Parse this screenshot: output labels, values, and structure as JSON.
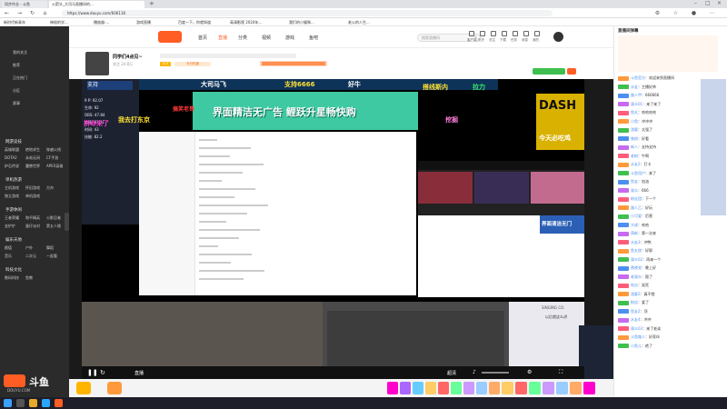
{
  "browser": {
    "tabs": [
      {
        "label": "同步作业 - 斗鱼"
      },
      {
        "label": "火箭头_大司马直播间的..."
      }
    ],
    "url": "https://www.douyu.com/606118",
    "bookmarks": [
      {
        "label": "新时代新青年"
      },
      {
        "label": "神秘的学..."
      },
      {
        "label": "播放器-..."
      },
      {
        "label": "游戏直播"
      },
      {
        "label": "百度一下，你就知道"
      },
      {
        "label": "高清影视 2024年..."
      },
      {
        "label": "我们的小猫咪..."
      },
      {
        "label": "老公的人生..."
      }
    ]
  },
  "sidebar": {
    "top_items": [
      {
        "label": "我的关注"
      },
      {
        "label": "推荐"
      },
      {
        "label": "正在热门"
      },
      {
        "label": "分区"
      },
      {
        "label": "赛事"
      }
    ],
    "sections": [
      {
        "title": "网游竞技",
        "items": [
          "英雄联盟",
          "绝地求生",
          "穿越火线",
          "DOTA2",
          "永劫无间",
          "CF手游",
          "炉石传说",
          "魔兽世界",
          "APEX英雄"
        ]
      },
      {
        "title": "单机热游",
        "items": [
          "主机游戏",
          "怀旧游戏",
          "方舟",
          "独立游戏",
          "单机游戏"
        ]
      },
      {
        "title": "手游休闲",
        "items": [
          "王者荣耀",
          "和平精英",
          "火影忍者",
          "金铲铲",
          "蛋仔派对",
          "第五人格"
        ]
      },
      {
        "title": "娱乐天地",
        "items": [
          "颜值",
          "户外",
          "舞蹈",
          "音乐",
          "二次元",
          "一起看"
        ]
      },
      {
        "title": "科技文化",
        "items": [
          "数码科技",
          "鱼教"
        ]
      }
    ],
    "logo_text": "斗鱼",
    "logo_sub": "DOUYU.COM"
  },
  "header": {
    "nav": [
      {
        "label": "首页"
      },
      {
        "label": "直播"
      },
      {
        "label": "分类"
      },
      {
        "label": "视频"
      },
      {
        "label": "游戏"
      },
      {
        "label": "鱼吧"
      }
    ],
    "search_placeholder": "搜索直播间",
    "icons_labels": [
      "客户端",
      "历史",
      "关注",
      "下载",
      "任务",
      "消息",
      "我的"
    ]
  },
  "room": {
    "streamer_name": "同学们4点见~",
    "line2": "关注 24.8万",
    "tags": [
      "LV.5",
      "今日热度"
    ]
  },
  "stream": {
    "left_stats": [
      "9 P: 92.07",
      "生命: 92",
      "OBS: 47.84",
      "攻速: 82.31",
      "时间: 43",
      "技能: 82.2"
    ],
    "top_banner": "大司马飞",
    "banner_left": "支持",
    "banner_mid": "支持6666",
    "banner_right": "好牛",
    "big_banner": "界面精洁无广告 鲤跃升星畅快购",
    "overlay_right_title": "DASH",
    "overlay_right_sub": "今天必吃鸡",
    "overlay_labels": [
      "搞笑老哥",
      "搭线斯内",
      "拉力",
      "挖掘",
      "我去打东京",
      "拼命来了"
    ],
    "game_title": "界面清洁无门",
    "watermark": "SINGING CO.",
    "subtitle": "以后就这么讲"
  },
  "controls": {
    "live_label": "直播",
    "quality": "超清"
  },
  "chat": {
    "title": "直播间弹幕",
    "lines": [
      {
        "user": "斗鱼官方",
        "text": "欢迎来到直播间"
      },
      {
        "user": "水友",
        "text": "主播好帅"
      },
      {
        "user": "路人甲",
        "text": "666666"
      },
      {
        "user": "观众01",
        "text": "来了来了"
      },
      {
        "user": "鱼丸",
        "text": "哈哈哈哈"
      },
      {
        "user": "小鱼",
        "text": "冲冲冲"
      },
      {
        "user": "游客",
        "text": "太强了"
      },
      {
        "user": "铁粉",
        "text": "好看"
      },
      {
        "user": "新人",
        "text": "支持支持"
      },
      {
        "user": "老粉",
        "text": "牛啊"
      },
      {
        "user": "水友2",
        "text": "打卡"
      },
      {
        "user": "斗鱼用户",
        "text": "来了"
      },
      {
        "user": "鱼友",
        "text": "加油"
      },
      {
        "user": "观众",
        "text": "666"
      },
      {
        "user": "粉丝团",
        "text": "下一个"
      },
      {
        "user": "路人乙",
        "text": "好玩"
      },
      {
        "user": "小可爱",
        "text": "厉害"
      },
      {
        "user": "大佬",
        "text": "哈哈"
      },
      {
        "user": "萌新",
        "text": "第一次来"
      },
      {
        "user": "水友3",
        "text": "冲鸭"
      },
      {
        "user": "鱼丸侠",
        "text": "好耶"
      },
      {
        "user": "观众02",
        "text": "再来一个"
      },
      {
        "user": "熬夜党",
        "text": "晚上好"
      },
      {
        "user": "老观众",
        "text": "稳了"
      },
      {
        "user": "吃瓜",
        "text": "笑死"
      },
      {
        "user": "游客2",
        "text": "真不错"
      },
      {
        "user": "粉丝",
        "text": "爱了"
      },
      {
        "user": "鱼友2",
        "text": "顶"
      },
      {
        "user": "水友4",
        "text": "冲冲"
      },
      {
        "user": "观众03",
        "text": "来了老弟"
      },
      {
        "user": "斗鱼路人",
        "text": "好家伙"
      },
      {
        "user": "小鱼儿",
        "text": "绝了"
      }
    ]
  },
  "colors": {
    "accent": "#ff5d23",
    "sidebar_bg": "#2b2b2b",
    "banner_green": "#3fc9a3"
  }
}
